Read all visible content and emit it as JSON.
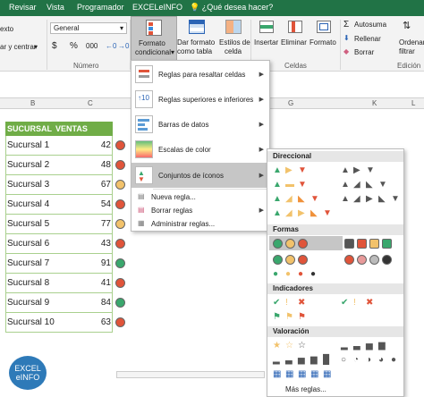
{
  "tabs": [
    "Revisar",
    "Vista",
    "Programador",
    "EXCELeINFO",
    "¿Qué desea hacer?"
  ],
  "ribbon": {
    "left_text": "exto",
    "align_label": "ar y centrar",
    "number_format": "General",
    "currency": "$",
    "percent": "%",
    "thousands": "000",
    "group_number": "Número",
    "group_cells": "Celdas",
    "group_edit": "Edición",
    "cond_format": "Formato condicional",
    "cond_format_l1": "Formato",
    "cond_format_l2": "condicional",
    "table_format_l1": "Dar formato",
    "table_format_l2": "como tabla",
    "cell_styles_l1": "Estilos de",
    "cell_styles_l2": "celda",
    "insert": "Insertar",
    "delete": "Eliminar",
    "format": "Formato",
    "autosum": "Autosuma",
    "fill": "Rellenar",
    "clear": "Borrar",
    "sort_l1": "Ordenar",
    "sort_l2": "filtrar"
  },
  "columns": {
    "b": "B",
    "c": "C",
    "g": "G",
    "k": "K",
    "l": "L"
  },
  "table": {
    "header_name": "SUCURSAL",
    "header_sales": "VENTAS",
    "rows": [
      {
        "name": "Sucursal 1",
        "value": "42",
        "color": "#e0543a"
      },
      {
        "name": "Sucursal 2",
        "value": "48",
        "color": "#e0543a"
      },
      {
        "name": "Sucursal 3",
        "value": "67",
        "color": "#f2c26b"
      },
      {
        "name": "Sucursal 4",
        "value": "54",
        "color": "#e0543a"
      },
      {
        "name": "Sucursal 5",
        "value": "77",
        "color": "#f2c26b"
      },
      {
        "name": "Sucursal 6",
        "value": "43",
        "color": "#e0543a"
      },
      {
        "name": "Sucursal 7",
        "value": "91",
        "color": "#3aa76d"
      },
      {
        "name": "Sucursal 8",
        "value": "41",
        "color": "#e0543a"
      },
      {
        "name": "Sucursal 9",
        "value": "84",
        "color": "#3aa76d"
      },
      {
        "name": "Sucursal 10",
        "value": "63",
        "color": "#e0543a"
      }
    ]
  },
  "menu": {
    "items": [
      {
        "label": "Reglas para resaltar celdas"
      },
      {
        "label": "Reglas superiores e inferiores"
      },
      {
        "label": "Barras de datos"
      },
      {
        "label": "Escalas de color"
      },
      {
        "label": "Conjuntos de íconos"
      }
    ],
    "small": [
      "Nueva regla...",
      "Borrar reglas",
      "Administrar reglas..."
    ]
  },
  "submenu": {
    "sections": [
      "Direccional",
      "Formas",
      "Indicadores",
      "Valoración"
    ],
    "more_rules": "Más reglas..."
  },
  "logo": {
    "l1": "EXCEL",
    "l2": "eINFO"
  },
  "colors": {
    "excel_green": "#217346",
    "header_green": "#70ad47",
    "selected": "#c6c6c6"
  }
}
